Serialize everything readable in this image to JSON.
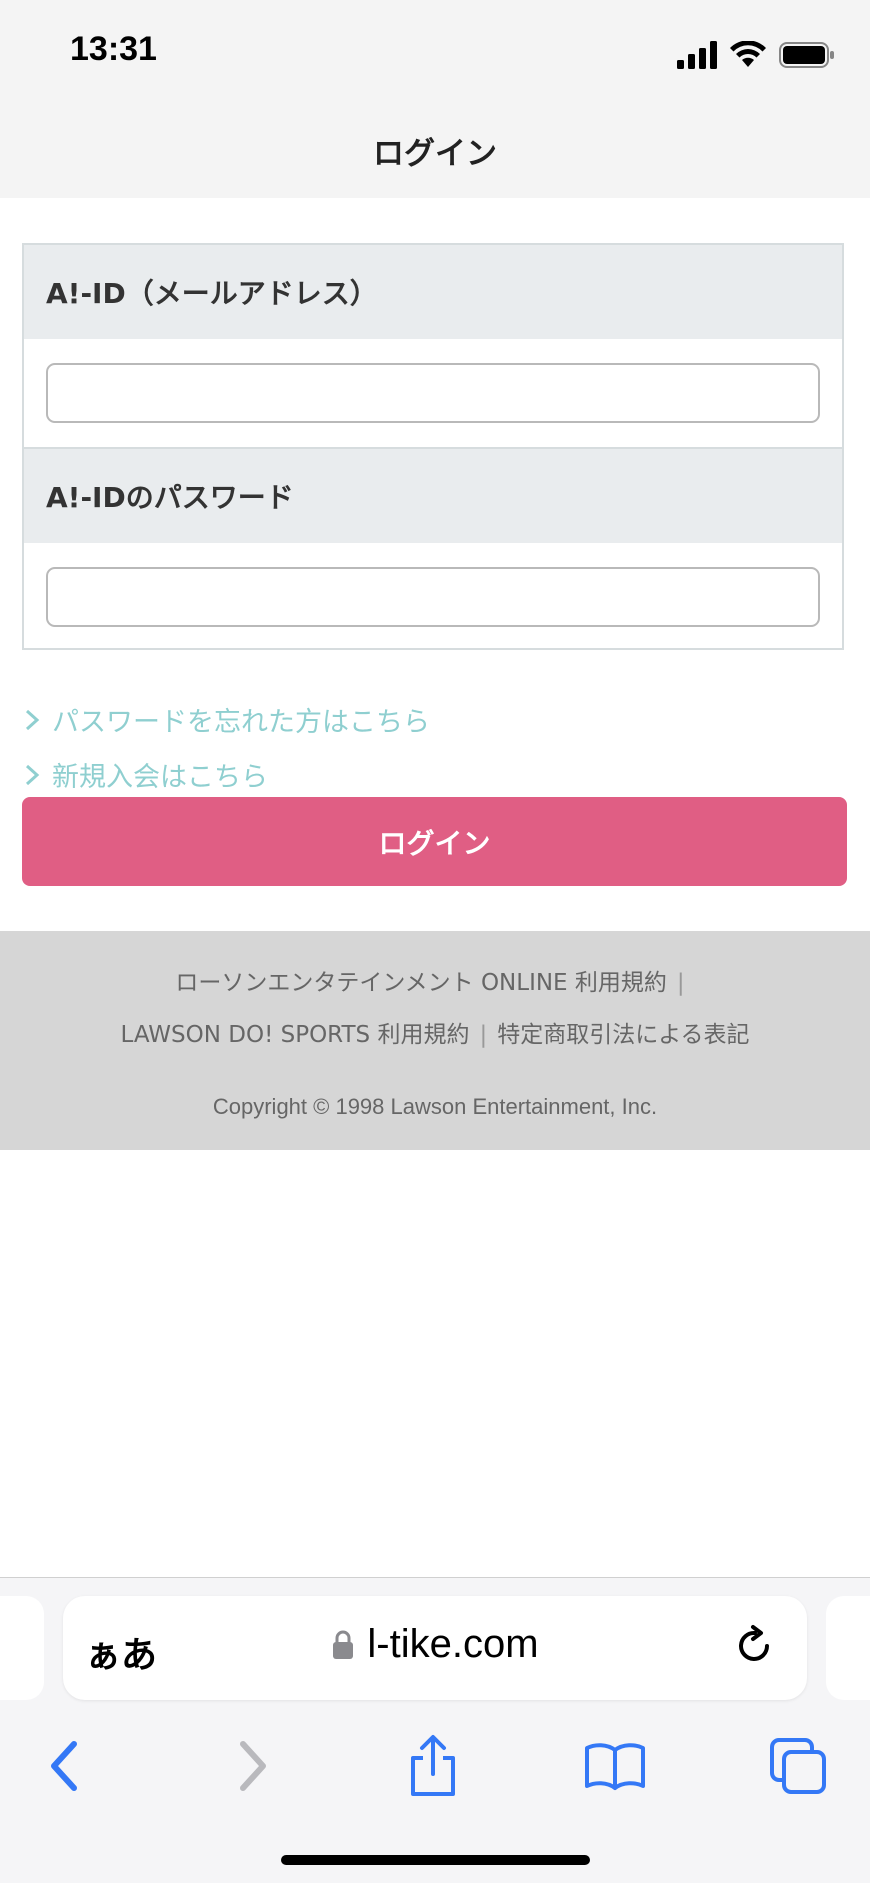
{
  "status_bar": {
    "time": "13:31"
  },
  "header": {
    "title": "ログイン"
  },
  "form": {
    "email_label": "A!-ID（メールアドレス）",
    "email_value": "",
    "password_label": "A!-IDのパスワード",
    "password_value": ""
  },
  "links": {
    "forgot_password": "パスワードを忘れた方はこちら",
    "register": "新規入会はこちら"
  },
  "login_button_label": "ログイン",
  "footer": {
    "link1": "ローソンエンタテインメント ONLINE 利用規約",
    "link2": "LAWSON DO! SPORTS 利用規約",
    "link3": "特定商取引法による表記",
    "separator": "|",
    "copyright": "Copyright © 1998 Lawson Entertainment, Inc."
  },
  "browser": {
    "aa_label": "ぁあ",
    "url": "l-tike.com"
  },
  "colors": {
    "accent": "#e05e84",
    "link": "#8fcfd0",
    "footer_bg": "#d6d6d6",
    "safari_blue": "#3478f6"
  }
}
